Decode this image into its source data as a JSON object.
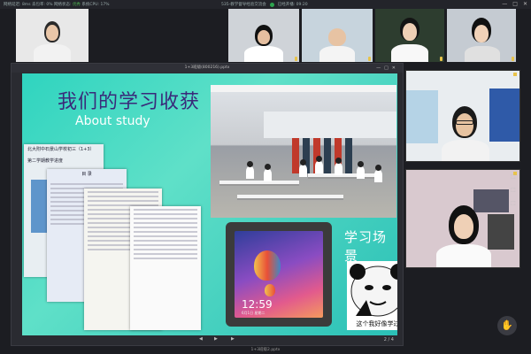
{
  "app": {
    "stats": {
      "prefix": "网络延迟: 8ms 丢包率: 0% 网络状态:",
      "status": "优秀",
      "cpu": "系统CPU: 17%"
    },
    "meeting_title": "535-教学督导经验交流会",
    "timer": "已经开播: 09:20",
    "window_controls": [
      "—",
      "□",
      "✕"
    ]
  },
  "participants_strip": [
    {
      "name": "",
      "bg": "#dcdcdc"
    },
    {
      "name": "",
      "bg": "#cfd3d8"
    },
    {
      "name": "",
      "bg": "#b9c5cf"
    },
    {
      "name": "",
      "bg": "#2d3d2f"
    },
    {
      "name": "",
      "bg": "#c5cbd2"
    }
  ],
  "slide_window": {
    "title": "1+3班级(800216).pptx",
    "page": "2 / 4",
    "play_icon": "▶",
    "prev_icon": "◀",
    "next_icon": "▶"
  },
  "slide": {
    "title_cn": "我们的学习收获",
    "title_en": "About study",
    "paper1_header": "北大附中石景山学校初三（1+3）",
    "paper1_sub": "第二学期教学进度",
    "paper2_header": "目 录",
    "ipad_time": "12:59",
    "ipad_date": "6月1日 星期二",
    "scene_title": "学习场景",
    "meme_caption": "这个我好像学过"
  },
  "bottom_filename": "1+3班级2.pptx",
  "side_videos": [
    {
      "name": "boy-glasses"
    },
    {
      "name": "girl"
    }
  ],
  "hand_icon": "✋",
  "side_controls": [
    "⬚",
    "⬚",
    "⬚"
  ],
  "colors": {
    "accent": "#2fd4bf",
    "title_purple": "#3a2a7a",
    "status_good": "#4caf50"
  }
}
